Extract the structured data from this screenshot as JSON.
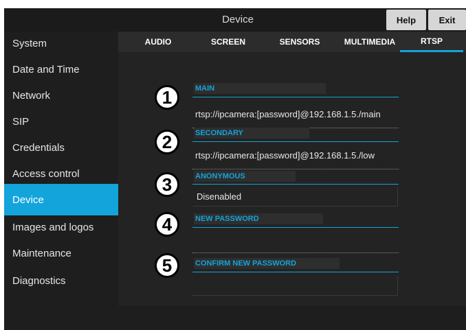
{
  "header": {
    "title": "Device",
    "help_label": "Help",
    "exit_label": "Exit"
  },
  "sidebar": {
    "items": [
      {
        "label": "System"
      },
      {
        "label": "Date and Time"
      },
      {
        "label": "Network"
      },
      {
        "label": "SIP"
      },
      {
        "label": "Credentials"
      },
      {
        "label": "Access control"
      },
      {
        "label": "Device"
      },
      {
        "label": "Images and logos"
      },
      {
        "label": "Maintenance"
      },
      {
        "label": "Diagnostics"
      }
    ],
    "active": "Device"
  },
  "tabs": [
    {
      "label": "AUDIO"
    },
    {
      "label": "SCREEN"
    },
    {
      "label": "SENSORS"
    },
    {
      "label": "MULTIMEDIA"
    },
    {
      "label": "RTSP"
    }
  ],
  "active_tab": "RTSP",
  "form": {
    "main": {
      "label": "MAIN",
      "value": "rtsp://ipcamera:[password]@192.168.1.5./main"
    },
    "secondary": {
      "label": "SECONDARY",
      "value": "rtsp://ipcamera:[password]@192.168.1.5./low"
    },
    "anonymous": {
      "label": "ANONYMOUS",
      "value": "Disenabled"
    },
    "new_password": {
      "label": "NEW PASSWORD",
      "value": ""
    },
    "confirm_password": {
      "label": "CONFIRM NEW PASSWORD",
      "value": ""
    }
  },
  "badges": [
    "1",
    "2",
    "3",
    "4",
    "5"
  ],
  "colors": {
    "accent": "#13a4dc",
    "background": "#1e1e1e"
  }
}
